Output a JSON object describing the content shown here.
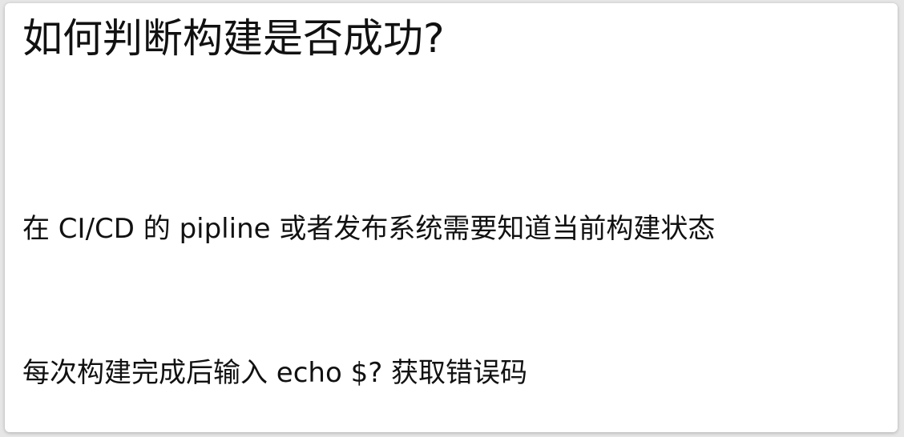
{
  "slide": {
    "title": "如何判断构建是否成功?",
    "lines": [
      "在 CI/CD 的 pipline 或者发布系统需要知道当前构建状态",
      "每次构建完成后输入 echo $? 获取错误码"
    ]
  }
}
